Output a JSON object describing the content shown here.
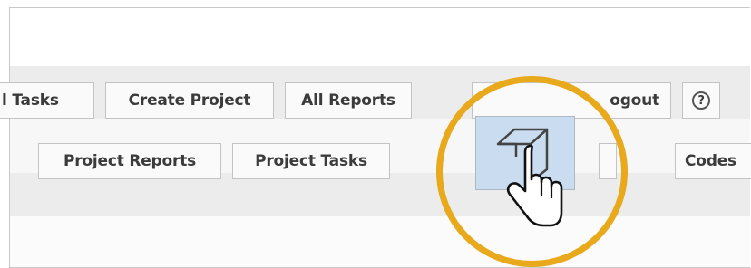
{
  "toolbar_row1": {
    "all_tasks_label": "l Tasks",
    "create_project_label": "Create Project",
    "all_reports_label": "All Reports",
    "logout_label": "ogout",
    "help_label": "?"
  },
  "toolbar_row2": {
    "project_reports_label": "Project Reports",
    "project_tasks_label": "Project Tasks",
    "codes_label": "Codes"
  },
  "icons": {
    "highlighted_button_icon": "box-icon",
    "help_icon": "question-circle-icon",
    "cursor": "hand-pointer-icon"
  },
  "colors": {
    "highlight_ring": "#e9a91c",
    "selected_button_bg": "#c9dcf0",
    "toolbar_band": "#ececec"
  }
}
